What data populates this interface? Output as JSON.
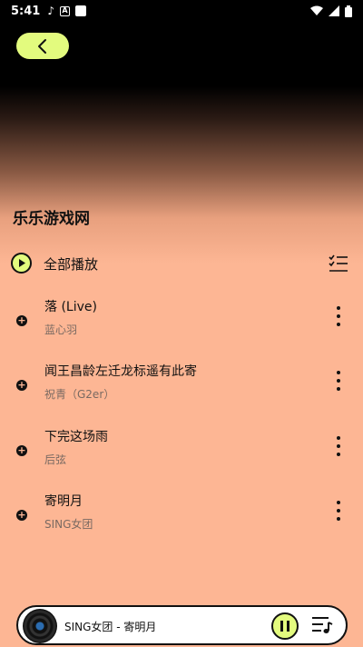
{
  "status_bar": {
    "time": "5:41"
  },
  "header": {
    "back_icon": "chevron-left-icon"
  },
  "playlist": {
    "title": "乐乐游戏网",
    "play_all_label": "全部播放"
  },
  "songs": [
    {
      "title": "落 (Live)",
      "artist": "蓝心羽"
    },
    {
      "title": "闻王昌龄左迁龙标遥有此寄",
      "artist": "祝青（G2er）"
    },
    {
      "title": "下完这场雨",
      "artist": "后弦"
    },
    {
      "title": "寄明月",
      "artist": "SING女团"
    }
  ],
  "player": {
    "now_playing": "SING女团 - 寄明月"
  },
  "colors": {
    "accent": "#e3fb7e",
    "background": "#fdb694",
    "header_dark": "#000000"
  }
}
